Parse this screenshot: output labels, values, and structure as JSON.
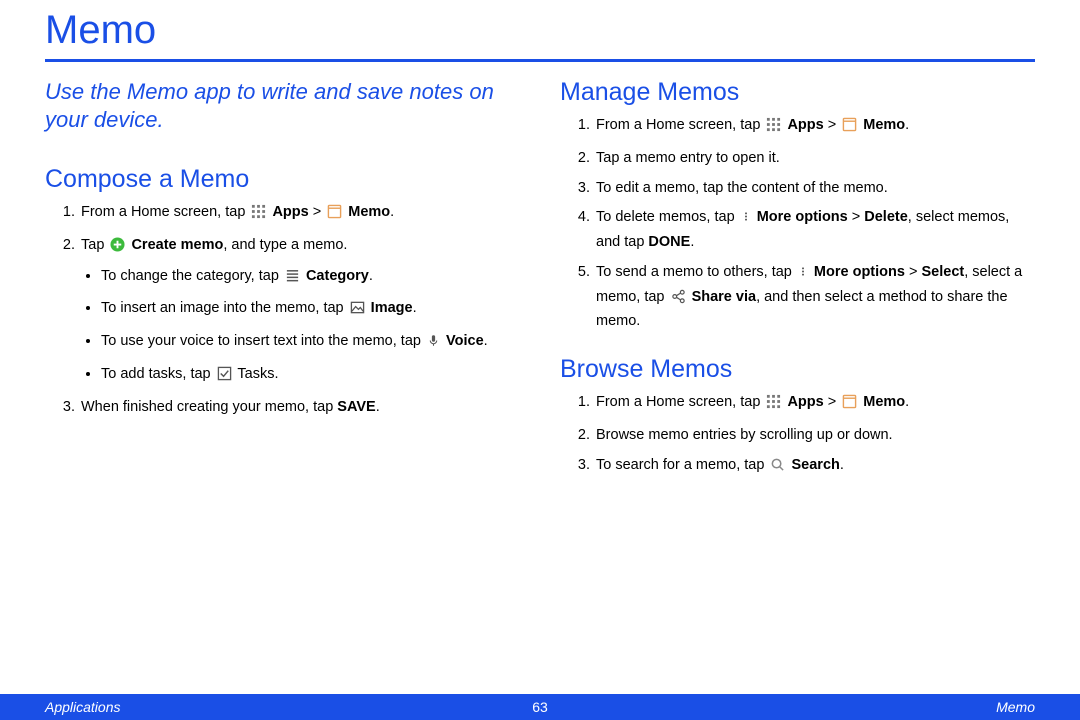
{
  "title": "Memo",
  "intro": "Use the Memo app to write and save notes on your device.",
  "icons": {
    "apps": "apps-grid-icon",
    "memo": "memo-icon",
    "create": "plus-circle-icon",
    "category": "list-icon",
    "image": "image-icon",
    "voice": "microphone-icon",
    "tasks": "checkbox-icon",
    "more": "more-vertical-icon",
    "share": "share-icon",
    "search": "search-icon"
  },
  "left": {
    "section_title": "Compose a Memo",
    "step1_a": "From a Home screen, tap ",
    "step1_apps": "Apps",
    "step1_gt": " > ",
    "step1_memo": "Memo",
    "step1_end": ".",
    "step2_a": "Tap ",
    "step2_create": "Create memo",
    "step2_end": ", and type a memo.",
    "bullet1_a": "To change the category, tap ",
    "bullet1_cat": "Category",
    "bullet1_end": ".",
    "bullet2_a": "To insert an image into the memo, tap ",
    "bullet2_img": "Image",
    "bullet2_end": ".",
    "bullet3_a": "To use your voice to insert text into the memo, tap ",
    "bullet3_voice": "Voice",
    "bullet3_end": ".",
    "bullet4_a": "To add tasks, tap ",
    "bullet4_tasks": " Tasks.",
    "step3_a": "When finished creating your memo, tap ",
    "step3_save": "SAVE",
    "step3_end": "."
  },
  "right": {
    "manage_title": "Manage Memos",
    "m1_a": "From a Home screen, tap ",
    "m1_apps": "Apps",
    "m1_gt": " > ",
    "m1_memo": "Memo",
    "m1_end": ".",
    "m2": "Tap a memo entry to open it.",
    "m3": "To edit a memo, tap the content of the memo.",
    "m4_a": "To delete memos, tap ",
    "m4_more": "More options",
    "m4_gt": " > ",
    "m4_del": "Delete",
    "m4_b": ", select memos, and tap ",
    "m4_done": "DONE",
    "m4_end": ".",
    "m5_a": "To send a memo to others, tap ",
    "m5_more": "More options",
    "m5_gt": " > ",
    "m5_sel": "Select",
    "m5_b": ", select a memo, tap ",
    "m5_share": "Share via",
    "m5_c": ", and then select a method to share the memo.",
    "browse_title": "Browse Memos",
    "b1_a": "From a Home screen, tap ",
    "b1_apps": "Apps",
    "b1_gt": " > ",
    "b1_memo": "Memo",
    "b1_end": ".",
    "b2": "Browse memo entries by scrolling up or down.",
    "b3_a": "To search for a memo, tap ",
    "b3_search": "Search",
    "b3_end": "."
  },
  "footer": {
    "left": "Applications",
    "center": "63",
    "right": "Memo"
  }
}
